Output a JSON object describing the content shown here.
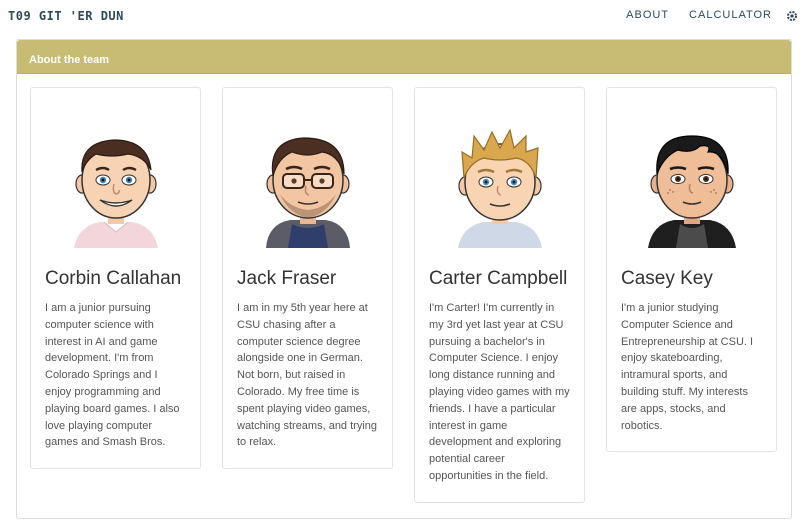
{
  "navbar": {
    "brand": "T09 GIT 'ER DUN",
    "links": [
      "ABOUT",
      "CALCULATOR"
    ],
    "settings_icon": "gear-icon"
  },
  "panel": {
    "title": "About the team"
  },
  "team": [
    {
      "name": "Corbin Callahan",
      "bio": "I am a junior pursuing computer science with interest in AI and game development. I'm from Colorado Springs and I enjoy programming and playing board games. I also love playing computer games and Smash Bros.",
      "avatar_icon": "avatar-icon"
    },
    {
      "name": "Jack Fraser",
      "bio": "I am in my 5th year here at CSU chasing after a computer science degree alongside one in German. Not born, but raised in Colorado. My free time is spent playing video games, watching streams, and trying to relax.",
      "avatar_icon": "avatar-icon"
    },
    {
      "name": "Carter Campbell",
      "bio": "I'm Carter! I'm currently in my 3rd yet last year at CSU pursuing a bachelor's in Computer Science. I enjoy long distance running and playing video games with my friends. I have a particular interest in game development and exploring potential career opportunities in the field.",
      "avatar_icon": "avatar-icon"
    },
    {
      "name": "Casey Key",
      "bio": "I'm a junior studying Computer Science and Entrepreneurship at CSU. I enjoy skateboarding, intramural sports, and building stuff. My interests are apps, stocks, and robotics.",
      "avatar_icon": "avatar-icon"
    }
  ],
  "colors": {
    "accent": "#c8bc75",
    "nav_text": "#2e4a5a"
  }
}
